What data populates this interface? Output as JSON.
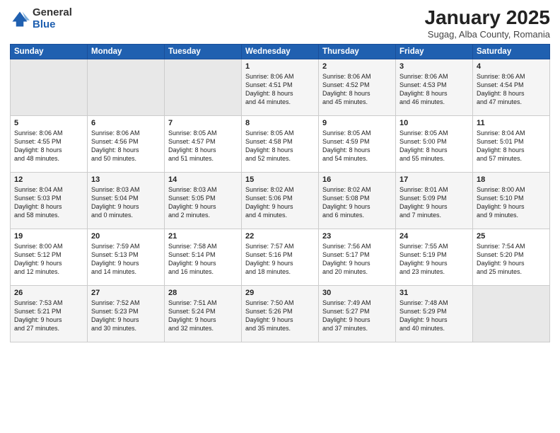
{
  "logo": {
    "general": "General",
    "blue": "Blue"
  },
  "header": {
    "title": "January 2025",
    "subtitle": "Sugag, Alba County, Romania"
  },
  "weekdays": [
    "Sunday",
    "Monday",
    "Tuesday",
    "Wednesday",
    "Thursday",
    "Friday",
    "Saturday"
  ],
  "weeks": [
    [
      {
        "day": "",
        "info": ""
      },
      {
        "day": "",
        "info": ""
      },
      {
        "day": "",
        "info": ""
      },
      {
        "day": "1",
        "info": "Sunrise: 8:06 AM\nSunset: 4:51 PM\nDaylight: 8 hours\nand 44 minutes."
      },
      {
        "day": "2",
        "info": "Sunrise: 8:06 AM\nSunset: 4:52 PM\nDaylight: 8 hours\nand 45 minutes."
      },
      {
        "day": "3",
        "info": "Sunrise: 8:06 AM\nSunset: 4:53 PM\nDaylight: 8 hours\nand 46 minutes."
      },
      {
        "day": "4",
        "info": "Sunrise: 8:06 AM\nSunset: 4:54 PM\nDaylight: 8 hours\nand 47 minutes."
      }
    ],
    [
      {
        "day": "5",
        "info": "Sunrise: 8:06 AM\nSunset: 4:55 PM\nDaylight: 8 hours\nand 48 minutes."
      },
      {
        "day": "6",
        "info": "Sunrise: 8:06 AM\nSunset: 4:56 PM\nDaylight: 8 hours\nand 50 minutes."
      },
      {
        "day": "7",
        "info": "Sunrise: 8:05 AM\nSunset: 4:57 PM\nDaylight: 8 hours\nand 51 minutes."
      },
      {
        "day": "8",
        "info": "Sunrise: 8:05 AM\nSunset: 4:58 PM\nDaylight: 8 hours\nand 52 minutes."
      },
      {
        "day": "9",
        "info": "Sunrise: 8:05 AM\nSunset: 4:59 PM\nDaylight: 8 hours\nand 54 minutes."
      },
      {
        "day": "10",
        "info": "Sunrise: 8:05 AM\nSunset: 5:00 PM\nDaylight: 8 hours\nand 55 minutes."
      },
      {
        "day": "11",
        "info": "Sunrise: 8:04 AM\nSunset: 5:01 PM\nDaylight: 8 hours\nand 57 minutes."
      }
    ],
    [
      {
        "day": "12",
        "info": "Sunrise: 8:04 AM\nSunset: 5:03 PM\nDaylight: 8 hours\nand 58 minutes."
      },
      {
        "day": "13",
        "info": "Sunrise: 8:03 AM\nSunset: 5:04 PM\nDaylight: 9 hours\nand 0 minutes."
      },
      {
        "day": "14",
        "info": "Sunrise: 8:03 AM\nSunset: 5:05 PM\nDaylight: 9 hours\nand 2 minutes."
      },
      {
        "day": "15",
        "info": "Sunrise: 8:02 AM\nSunset: 5:06 PM\nDaylight: 9 hours\nand 4 minutes."
      },
      {
        "day": "16",
        "info": "Sunrise: 8:02 AM\nSunset: 5:08 PM\nDaylight: 9 hours\nand 6 minutes."
      },
      {
        "day": "17",
        "info": "Sunrise: 8:01 AM\nSunset: 5:09 PM\nDaylight: 9 hours\nand 7 minutes."
      },
      {
        "day": "18",
        "info": "Sunrise: 8:00 AM\nSunset: 5:10 PM\nDaylight: 9 hours\nand 9 minutes."
      }
    ],
    [
      {
        "day": "19",
        "info": "Sunrise: 8:00 AM\nSunset: 5:12 PM\nDaylight: 9 hours\nand 12 minutes."
      },
      {
        "day": "20",
        "info": "Sunrise: 7:59 AM\nSunset: 5:13 PM\nDaylight: 9 hours\nand 14 minutes."
      },
      {
        "day": "21",
        "info": "Sunrise: 7:58 AM\nSunset: 5:14 PM\nDaylight: 9 hours\nand 16 minutes."
      },
      {
        "day": "22",
        "info": "Sunrise: 7:57 AM\nSunset: 5:16 PM\nDaylight: 9 hours\nand 18 minutes."
      },
      {
        "day": "23",
        "info": "Sunrise: 7:56 AM\nSunset: 5:17 PM\nDaylight: 9 hours\nand 20 minutes."
      },
      {
        "day": "24",
        "info": "Sunrise: 7:55 AM\nSunset: 5:19 PM\nDaylight: 9 hours\nand 23 minutes."
      },
      {
        "day": "25",
        "info": "Sunrise: 7:54 AM\nSunset: 5:20 PM\nDaylight: 9 hours\nand 25 minutes."
      }
    ],
    [
      {
        "day": "26",
        "info": "Sunrise: 7:53 AM\nSunset: 5:21 PM\nDaylight: 9 hours\nand 27 minutes."
      },
      {
        "day": "27",
        "info": "Sunrise: 7:52 AM\nSunset: 5:23 PM\nDaylight: 9 hours\nand 30 minutes."
      },
      {
        "day": "28",
        "info": "Sunrise: 7:51 AM\nSunset: 5:24 PM\nDaylight: 9 hours\nand 32 minutes."
      },
      {
        "day": "29",
        "info": "Sunrise: 7:50 AM\nSunset: 5:26 PM\nDaylight: 9 hours\nand 35 minutes."
      },
      {
        "day": "30",
        "info": "Sunrise: 7:49 AM\nSunset: 5:27 PM\nDaylight: 9 hours\nand 37 minutes."
      },
      {
        "day": "31",
        "info": "Sunrise: 7:48 AM\nSunset: 5:29 PM\nDaylight: 9 hours\nand 40 minutes."
      },
      {
        "day": "",
        "info": ""
      }
    ]
  ]
}
